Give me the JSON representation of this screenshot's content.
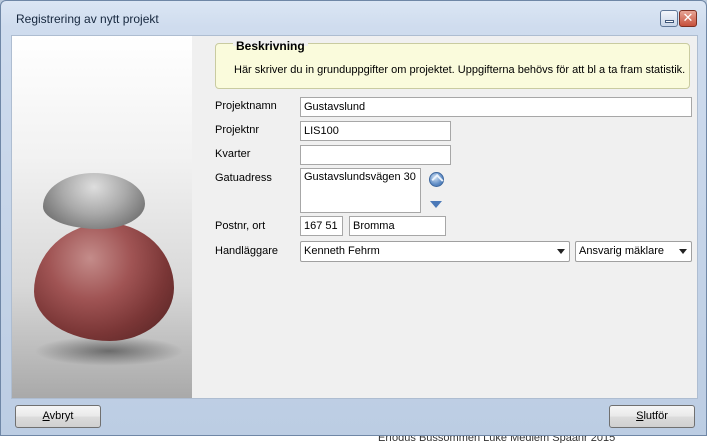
{
  "window": {
    "title": "Registrering av nytt projekt"
  },
  "description": {
    "title": "Beskrivning",
    "text": "Här skriver du in grunduppgifter om projektet. Uppgifterna behövs för att bl a ta fram statistik."
  },
  "form": {
    "projektnamn": {
      "label": "Projektnamn",
      "value": "Gustavslund"
    },
    "projektnr": {
      "label": "Projektnr",
      "value": "LIS100"
    },
    "kvarter": {
      "label": "Kvarter",
      "value": ""
    },
    "gatuadress": {
      "label": "Gatuadress",
      "value": "Gustavslundsvägen 30"
    },
    "postnr_ort": {
      "label": "Postnr, ort",
      "postnr": "167 51",
      "ort": "Bromma"
    },
    "handlaggare": {
      "label": "Handläggare",
      "value": "Kenneth Fehrm",
      "role": "Ansvarig mäklare"
    }
  },
  "buttons": {
    "cancel_first": "A",
    "cancel_rest": "vbryt",
    "finish_first": "S",
    "finish_rest": "lutför"
  },
  "background": {
    "text": "Erfodus  Bussommen  Luke Mediem  Spaanr  2015"
  },
  "icons": {
    "address_lookup": "globe-icon",
    "address_expand": "down-arrow-icon",
    "minimize": "minimize-icon",
    "close": "close-icon"
  },
  "colors": {
    "description_bg": "#fafbdc",
    "frame": "#bccde3",
    "close_button": "#c7503b",
    "icon_blue": "#4b79b8"
  }
}
